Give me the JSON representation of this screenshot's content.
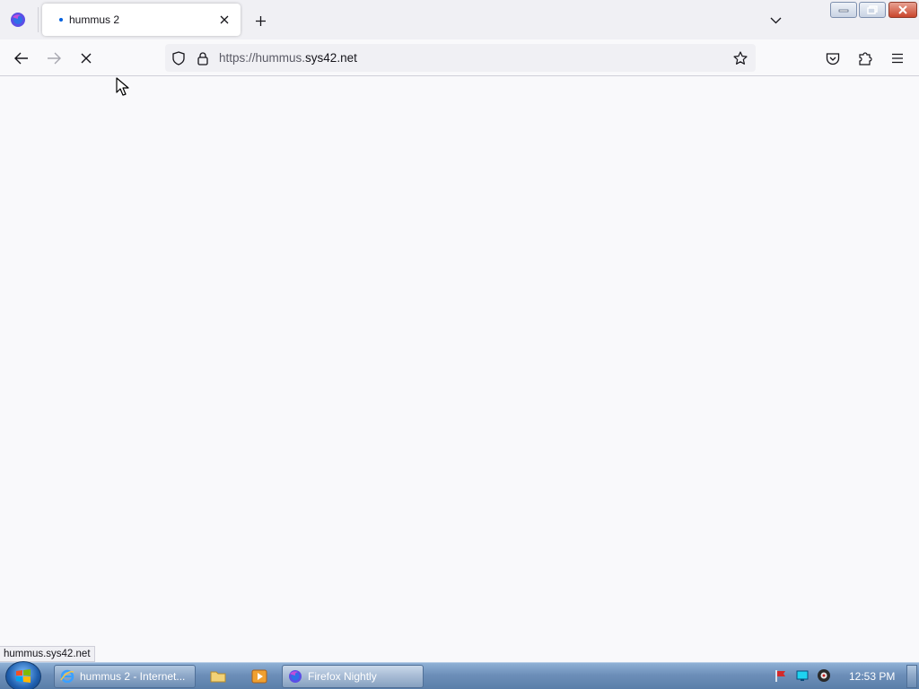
{
  "browser": {
    "tab": {
      "title": "hummus 2",
      "loading": true
    },
    "url": {
      "prefix": "https://hummus.",
      "host": "sys42.net"
    },
    "status_text": "hummus.sys42.net"
  },
  "icons": {
    "app": "firefox-logo-icon",
    "back": "back-arrow-icon",
    "forward": "forward-arrow-icon",
    "stop": "stop-icon",
    "shield": "tracking-protection-shield-icon",
    "lock": "lock-icon",
    "bookmark": "star-icon",
    "pocket": "pocket-icon",
    "extensions": "puzzle-icon",
    "menu": "hamburger-menu-icon"
  },
  "taskbar": {
    "items": [
      {
        "label": "hummus 2 - Internet..."
      },
      {
        "label": "Firefox Nightly"
      }
    ],
    "clock": "12:53 PM"
  },
  "colors": {
    "accent": "#0060df",
    "content_bg": "#f9f9fb",
    "toolbar_bg": "#f0f0f4"
  }
}
